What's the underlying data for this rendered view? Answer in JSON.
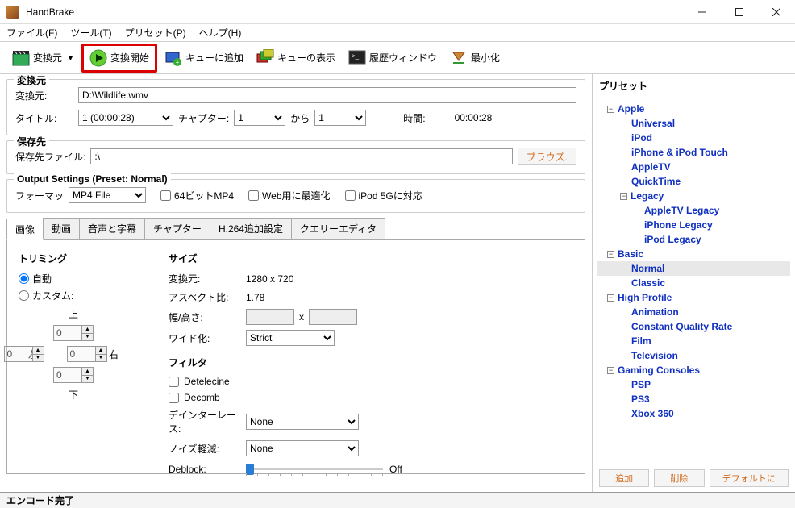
{
  "window": {
    "title": "HandBrake"
  },
  "menu": {
    "file": "ファイル(F)",
    "tools": "ツール(T)",
    "presets": "プリセット(P)",
    "help": "ヘルプ(H)"
  },
  "toolbar": {
    "source": "変換元",
    "start": "変換開始",
    "addqueue": "キューに追加",
    "showqueue": "キューの表示",
    "history": "履歴ウィンドウ",
    "minimize": "最小化"
  },
  "source": {
    "legend": "変換元",
    "label": "変換元:",
    "path": "D:\\Wildlife.wmv",
    "title_label": "タイトル:",
    "title_value": "1 (00:00:28)",
    "chapter_label": "チャプター:",
    "chapter_from": "1",
    "to_label": "から",
    "chapter_to": "1",
    "duration_label": "時間:",
    "duration_value": "00:00:28"
  },
  "dest": {
    "legend": "保存先",
    "label": "保存先ファイル:",
    "path": ":\\",
    "browse": "ブラウズ."
  },
  "output": {
    "legend": "Output Settings (Preset: Normal)",
    "format_label": "フォーマッ",
    "format_value": "MP4 File",
    "large": "64ビットMP4",
    "weboptim": "Web用に最適化",
    "ipod5g": "iPod 5Gに対応"
  },
  "tabs": {
    "picture": "画像",
    "video": "動画",
    "audio": "音声と字幕",
    "chapters": "チャプター",
    "h264": "H.264追加設定",
    "query": "クエリーエディタ"
  },
  "picture": {
    "trim_head": "トリミング",
    "auto": "自動",
    "custom": "カスタム:",
    "top": "上",
    "bottom": "下",
    "left": "左",
    "right": "右",
    "crop_val": "0",
    "size_head": "サイズ",
    "source_label": "変換元:",
    "source_dim": "1280 x 720",
    "aspect_label": "アスペクト比:",
    "aspect_val": "1.78",
    "wh_label": "幅/高さ:",
    "by": "x",
    "wide_label": "ワイド化:",
    "wide_value": "Strict",
    "filter_head": "フィルタ",
    "detelecine": "Detelecine",
    "decomb": "Decomb",
    "deinterlace_label": "デインターレース:",
    "deinterlace_value": "None",
    "denoise_label": "ノイズ軽減:",
    "denoise_value": "None",
    "deblock_label": "Deblock:",
    "deblock_off": "Off"
  },
  "presets": {
    "title": "プリセット",
    "btn_add": "追加",
    "btn_del": "削除",
    "btn_default": "デフォルトに",
    "apple": "Apple",
    "apple_items": [
      "Universal",
      "iPod",
      "iPhone & iPod Touch",
      "AppleTV",
      "QuickTime"
    ],
    "legacy": "Legacy",
    "legacy_items": [
      "AppleTV Legacy",
      "iPhone Legacy",
      "iPod Legacy"
    ],
    "basic": "Basic",
    "basic_items": [
      "Normal",
      "Classic"
    ],
    "high": "High Profile",
    "high_items": [
      "Animation",
      "Constant Quality Rate",
      "Film",
      "Television"
    ],
    "gaming": "Gaming Consoles",
    "gaming_items": [
      "PSP",
      "PS3",
      "Xbox 360"
    ]
  },
  "status": {
    "text": "エンコード完了"
  }
}
